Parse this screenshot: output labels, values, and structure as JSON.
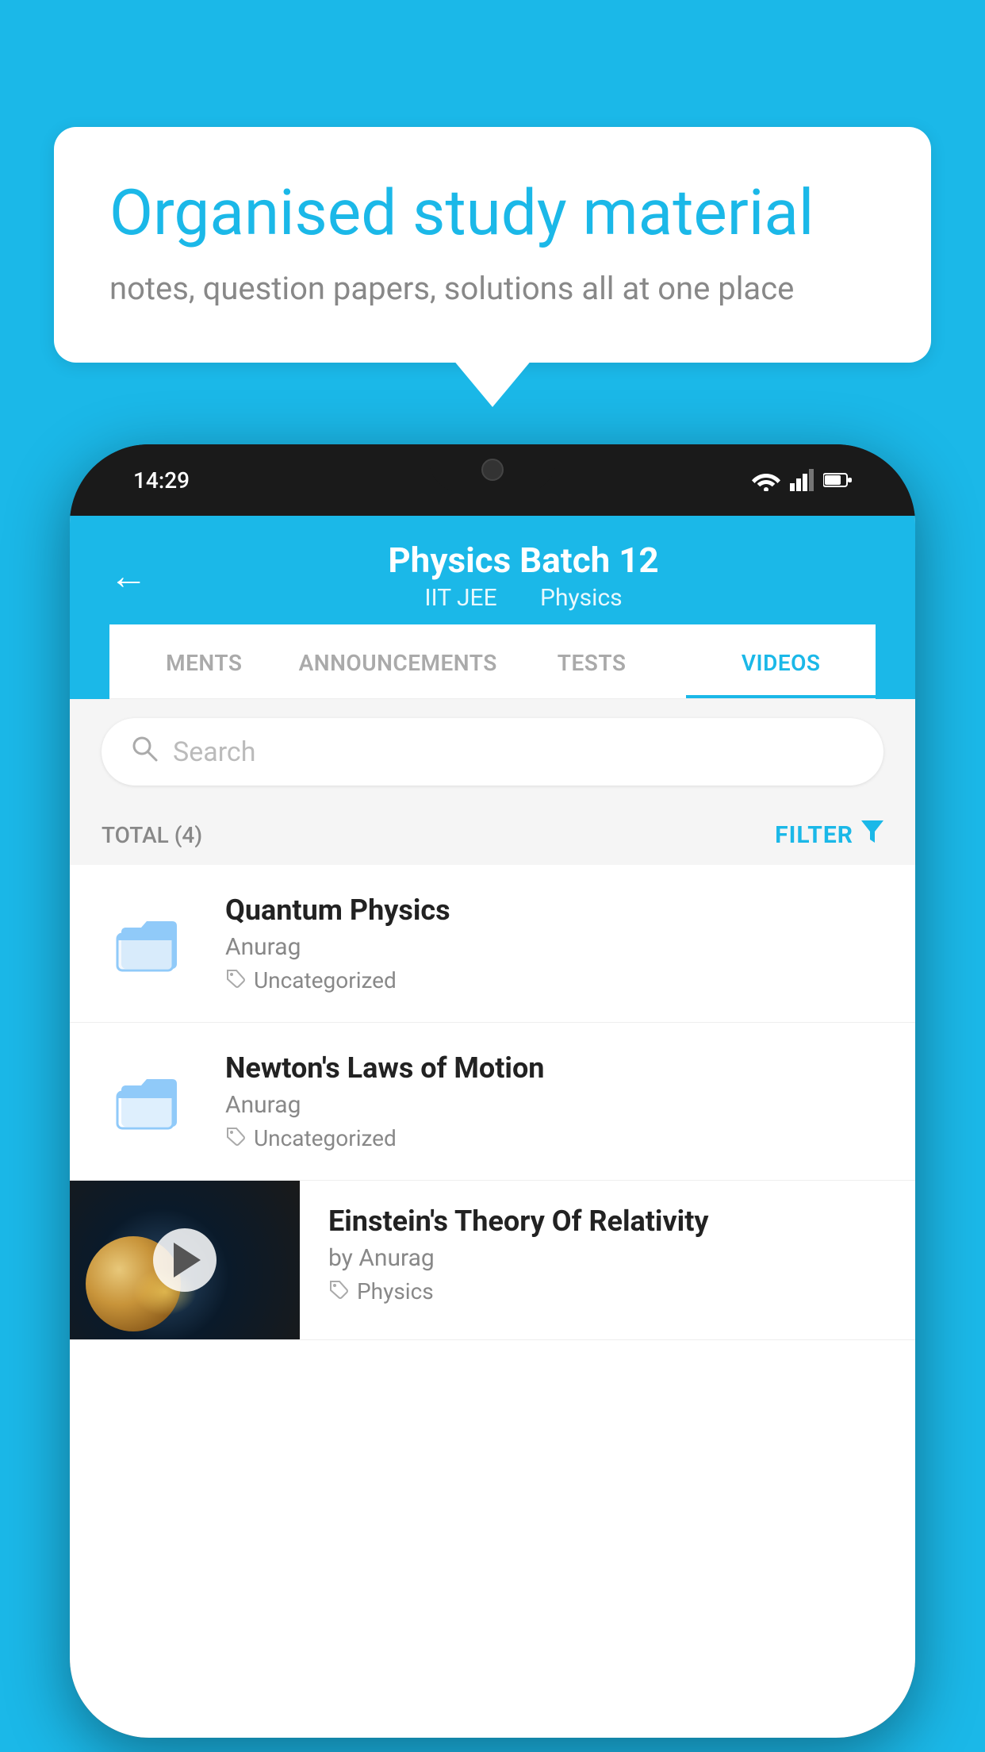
{
  "background_color": "#1BB8E8",
  "speech_bubble": {
    "title": "Organised study material",
    "subtitle": "notes, question papers, solutions all at one place"
  },
  "status_bar": {
    "time": "14:29",
    "icons": [
      "wifi",
      "signal",
      "battery"
    ]
  },
  "app_header": {
    "back_label": "←",
    "title": "Physics Batch 12",
    "subtitle_parts": [
      "IIT JEE",
      "Physics"
    ]
  },
  "tabs": [
    {
      "label": "MENTS",
      "active": false
    },
    {
      "label": "ANNOUNCEMENTS",
      "active": false
    },
    {
      "label": "TESTS",
      "active": false
    },
    {
      "label": "VIDEOS",
      "active": true
    }
  ],
  "search": {
    "placeholder": "Search"
  },
  "filter_row": {
    "total_label": "TOTAL (4)",
    "filter_label": "FILTER"
  },
  "list_items": [
    {
      "title": "Quantum Physics",
      "author": "Anurag",
      "tag": "Uncategorized",
      "type": "folder"
    },
    {
      "title": "Newton's Laws of Motion",
      "author": "Anurag",
      "tag": "Uncategorized",
      "type": "folder"
    },
    {
      "title": "Einstein's Theory Of Relativity",
      "author": "by Anurag",
      "tag": "Physics",
      "type": "video"
    }
  ]
}
